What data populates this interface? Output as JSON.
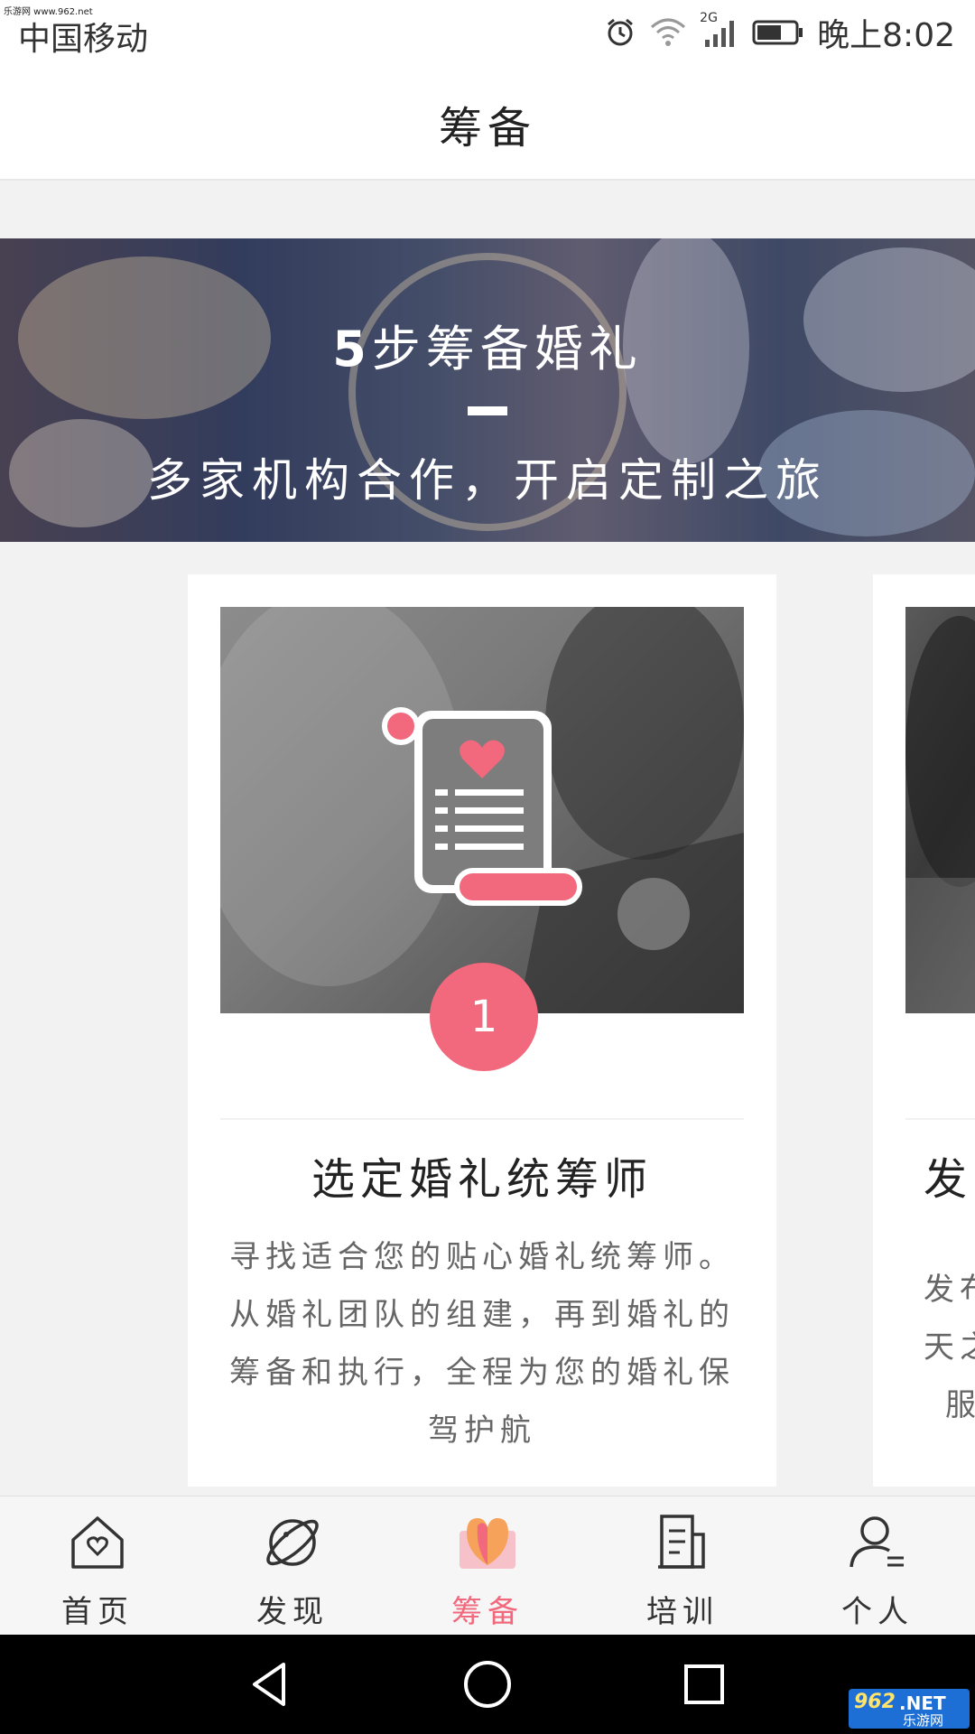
{
  "watermark": "乐游网 www.962.net",
  "status_bar": {
    "carrier": "中国移动",
    "network": "2G",
    "time": "晚上8:02"
  },
  "header": {
    "title": "筹备"
  },
  "banner": {
    "title_number": "5",
    "title_text": "步筹备婚礼",
    "subtitle": "多家机构合作，开启定制之旅"
  },
  "cards": [
    {
      "step": "1",
      "title": "选定婚礼统筹师",
      "description": "寻找适合您的贴心婚礼统筹师。从婚礼团队的组建，再到婚礼的筹备和执行，全程为您的婚礼保驾护航",
      "icon": "scroll-heart-icon"
    },
    {
      "title": "发",
      "description_lines": [
        "发布",
        "天之",
        "服"
      ]
    }
  ],
  "tabbar": {
    "items": [
      {
        "label": "首页",
        "icon": "home-heart-icon"
      },
      {
        "label": "发现",
        "icon": "planet-icon"
      },
      {
        "label": "筹备",
        "icon": "open-heart-book-icon",
        "active": true
      },
      {
        "label": "培训",
        "icon": "document-icon"
      },
      {
        "label": "个人",
        "icon": "person-icon"
      }
    ]
  },
  "site_badge": {
    "logo": "962",
    "name": ".NET",
    "tagline": "乐游网"
  },
  "colors": {
    "accent": "#f2697e",
    "text": "#222222",
    "muted": "#666666"
  }
}
